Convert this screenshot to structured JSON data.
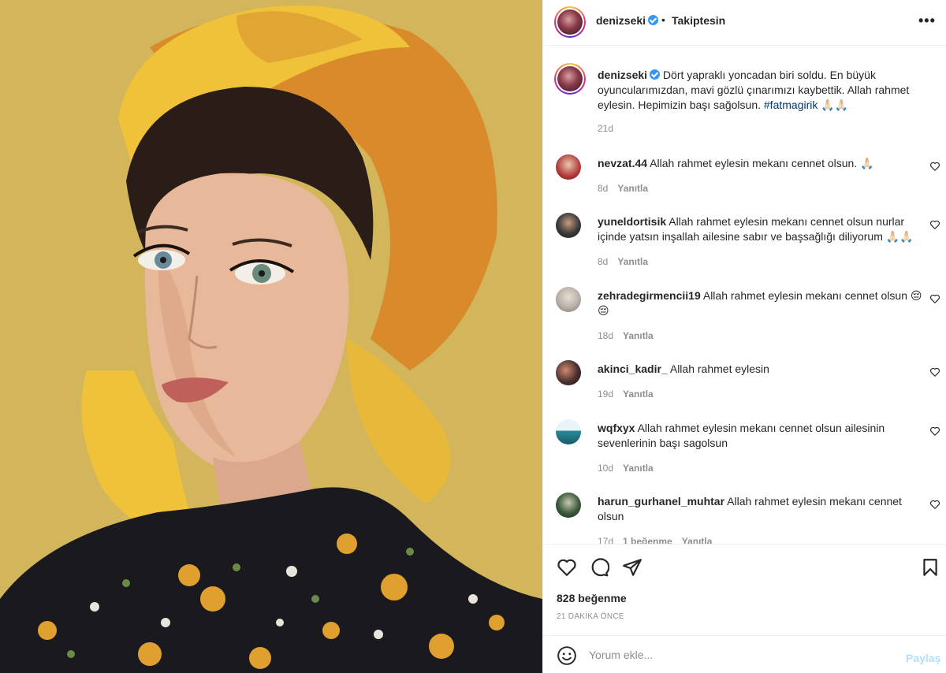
{
  "post": {
    "image_alt": "Portrait photo",
    "header": {
      "username": "denizseki",
      "separator": "•",
      "follow_label": "Takiptesin",
      "more_label": "•••"
    },
    "caption": {
      "username": "denizseki",
      "text": "Dört yapraklı yoncadan biri soldu. En büyük oyuncularımızdan, mavi gözlü çınarımızı kaybettik. Allah rahmet eylesin. Hepimizin başı sağolsun.",
      "hashtag": "#fatmagirik",
      "emoji": "🙏🏻🙏🏻",
      "time": "21d"
    },
    "comments": [
      {
        "username": "nevzat.44",
        "text": "Allah rahmet eylesin mekanı cennet olsun. 🙏🏻",
        "time": "8d",
        "likes": "",
        "reply": "Yanıtla",
        "avatar_color": "#b03a3a"
      },
      {
        "username": "yuneldortisik",
        "text": "Allah rahmet eylesin mekanı cennet olsun nurlar içinde yatsın inşallah ailesine sabır ve başsağlığı diliyorum 🙏🏻🙏🏻",
        "time": "8d",
        "likes": "",
        "reply": "Yanıtla",
        "avatar_color": "#3a3a3a"
      },
      {
        "username": "zehradegirmencii19",
        "text": "Allah rahmet eylesin mekanı cennet olsun 😔😔",
        "time": "18d",
        "likes": "",
        "reply": "Yanıtla",
        "avatar_color": "#b8b0a8"
      },
      {
        "username": "akinci_kadir_",
        "text": "Allah rahmet eylesin",
        "time": "19d",
        "likes": "",
        "reply": "Yanıtla",
        "avatar_color": "#4a3030"
      },
      {
        "username": "wqfxyx",
        "text": "Allah rahmet eylesin mekanı cennet olsun ailesinin sevenlerinin başı sagolsun",
        "time": "10d",
        "likes": "",
        "reply": "Yanıtla",
        "avatar_color": "#2a8a9a"
      },
      {
        "username": "harun_gurhanel_muhtar",
        "text": "Allah rahmet eylesin mekanı cennet olsun",
        "time": "17d",
        "likes": "1 beğenme",
        "reply": "Yanıtla",
        "avatar_color": "#3a5a3a"
      }
    ],
    "icons": {
      "like": "heart-icon",
      "comment": "comment-icon",
      "share": "paper-plane-icon",
      "save": "bookmark-icon",
      "emoji": "smiley-icon"
    },
    "likes_label": "828 beğenme",
    "time_ago": "21 DAKİKA ÖNCE",
    "add_comment": {
      "placeholder": "Yorum ekle...",
      "post_label": "Paylaş"
    }
  }
}
